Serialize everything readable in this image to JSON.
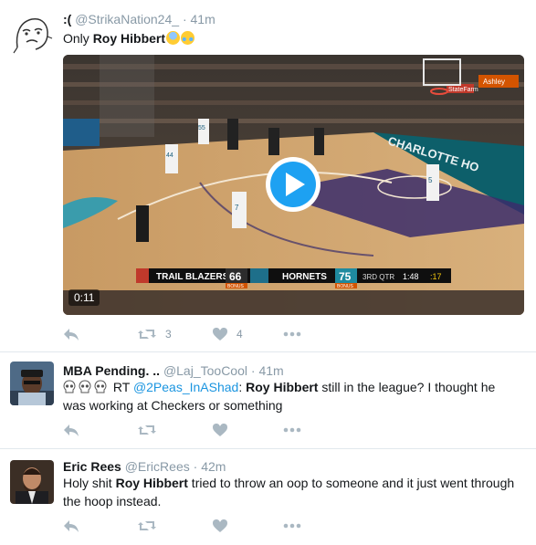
{
  "tweets": [
    {
      "name": ":(",
      "handle": "@StrikaNation24_",
      "dot": "·",
      "time": "41m",
      "text_pre": "Only ",
      "text_bold": "Roy Hibbert",
      "video": {
        "duration": "0:11",
        "scorebug": {
          "team1": "TRAIL BLAZERS",
          "score1": "66",
          "team2": "HORNETS",
          "score2": "75",
          "quarter": "3RD QTR",
          "clock": "1:48",
          "shot_clock": ":17",
          "bonus1": "BONUS",
          "bonus2": "BONUS"
        },
        "court_text": "CHARLOTTE HO",
        "ads": [
          "StateFarm",
          "Ashley"
        ],
        "jerseys": [
          "44",
          "55",
          "7",
          "5"
        ]
      },
      "actions": {
        "retweets": "3",
        "likes": "4"
      }
    },
    {
      "name": "MBA Pending. ..",
      "handle": "@Laj_TooCool",
      "dot": "·",
      "time": "41m",
      "text_rt": "RT ",
      "text_mention": "@2Peas_InAShad",
      "text_colon": ": ",
      "text_bold": "Roy Hibbert",
      "text_rest_line1": " still in the league? I thought he",
      "text_line2": "was working at Checkers or something"
    },
    {
      "name": "Eric Rees",
      "handle": "@EricRees",
      "dot": "·",
      "time": "42m",
      "text_pre": "Holy shit ",
      "text_bold": "Roy Hibbert",
      "text_rest_line1": " tried to throw an oop to someone and it just went through",
      "text_line2": "the hoop instead."
    }
  ],
  "colors": {
    "link": "#1b95e0",
    "muted": "#8899a6",
    "icon": "#aab8c2",
    "divider": "#e1e8ed",
    "play": "#1da1f2"
  },
  "icons": [
    "reply-icon",
    "retweet-icon",
    "heart-icon",
    "more-icon",
    "play-icon",
    "skull-icon",
    "fearful-face-emoji",
    "tears-of-joy-emoji"
  ]
}
